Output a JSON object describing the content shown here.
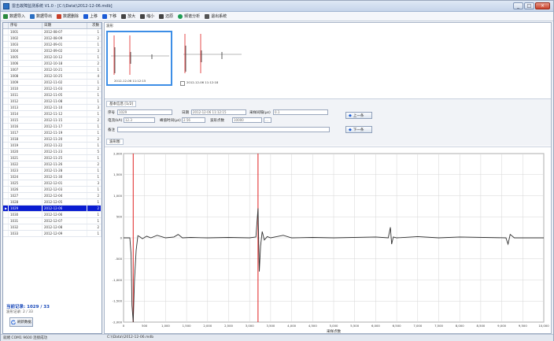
{
  "window": {
    "title": "雷击故障监测系统 V1.0 - [C:\\\\Data\\\\2012-12-06.mdb]",
    "controls": [
      "_",
      "□",
      "×"
    ]
  },
  "toolbar": {
    "items": [
      {
        "label": "数据导入",
        "icon": "import-icon"
      },
      {
        "label": "数据导出",
        "icon": "export-icon"
      },
      {
        "label": "数据删除",
        "icon": "delete-icon"
      },
      {
        "label": "上移",
        "icon": "up-icon"
      },
      {
        "label": "下移",
        "icon": "down-icon"
      },
      {
        "label": "放大",
        "icon": "zoom-in-icon"
      },
      {
        "label": "缩小",
        "icon": "zoom-out-icon"
      },
      {
        "label": "还原",
        "icon": "restore-icon"
      },
      {
        "label": "频谱分析",
        "icon": "analysis-icon"
      },
      {
        "label": "退出系统",
        "icon": "exit-icon"
      }
    ]
  },
  "list": {
    "headers": [
      "",
      "序号",
      "日期",
      "次数"
    ],
    "rows": [
      {
        "no": "1001",
        "date": "2012-08-07",
        "cnt": "1"
      },
      {
        "no": "1002",
        "date": "2012-08-09",
        "cnt": "2"
      },
      {
        "no": "1003",
        "date": "2012-09-01",
        "cnt": "1"
      },
      {
        "no": "1004",
        "date": "2012-09-02",
        "cnt": "3"
      },
      {
        "no": "1005",
        "date": "2012-10-12",
        "cnt": "1"
      },
      {
        "no": "1006",
        "date": "2012-10-18",
        "cnt": "2"
      },
      {
        "no": "1007",
        "date": "2012-10-21",
        "cnt": "1"
      },
      {
        "no": "1008",
        "date": "2012-10-25",
        "cnt": "4"
      },
      {
        "no": "1009",
        "date": "2012-11-02",
        "cnt": "1"
      },
      {
        "no": "1010",
        "date": "2012-11-03",
        "cnt": "2"
      },
      {
        "no": "1011",
        "date": "2012-11-05",
        "cnt": "1"
      },
      {
        "no": "1012",
        "date": "2012-11-08",
        "cnt": "1"
      },
      {
        "no": "1013",
        "date": "2012-11-10",
        "cnt": "3"
      },
      {
        "no": "1014",
        "date": "2012-11-12",
        "cnt": "1"
      },
      {
        "no": "1015",
        "date": "2012-11-15",
        "cnt": "2"
      },
      {
        "no": "1016",
        "date": "2012-11-17",
        "cnt": "1"
      },
      {
        "no": "1017",
        "date": "2012-11-19",
        "cnt": "1"
      },
      {
        "no": "1018",
        "date": "2012-11-20",
        "cnt": "2"
      },
      {
        "no": "1019",
        "date": "2012-11-22",
        "cnt": "1"
      },
      {
        "no": "1020",
        "date": "2012-11-23",
        "cnt": "5"
      },
      {
        "no": "1021",
        "date": "2012-11-25",
        "cnt": "1"
      },
      {
        "no": "1022",
        "date": "2012-11-26",
        "cnt": "2"
      },
      {
        "no": "1023",
        "date": "2012-11-28",
        "cnt": "1"
      },
      {
        "no": "1024",
        "date": "2012-11-30",
        "cnt": "1"
      },
      {
        "no": "1025",
        "date": "2012-12-01",
        "cnt": "3"
      },
      {
        "no": "1026",
        "date": "2012-12-03",
        "cnt": "1"
      },
      {
        "no": "1027",
        "date": "2012-12-04",
        "cnt": "2"
      },
      {
        "no": "1028",
        "date": "2012-12-05",
        "cnt": "1"
      },
      {
        "no": "1029",
        "date": "2012-12-06",
        "cnt": "2",
        "selected": true
      },
      {
        "no": "1030",
        "date": "2012-12-06",
        "cnt": "1"
      },
      {
        "no": "1031",
        "date": "2012-12-07",
        "cnt": "1"
      },
      {
        "no": "1032",
        "date": "2012-12-08",
        "cnt": "2"
      },
      {
        "no": "1033",
        "date": "2012-12-09",
        "cnt": "1"
      }
    ],
    "footer": {
      "code": "当前记录: 1029 / 33",
      "sub": "波形记录: 2 / 33",
      "refresh_label": "刷新数据"
    }
  },
  "thumbnails": {
    "tab_label": "波形",
    "items": [
      {
        "caption": "2012-12-06 11:12:15",
        "selected": true
      },
      {
        "caption": "2012-12-06 11:12:18",
        "selected": false
      }
    ]
  },
  "info": {
    "tab_label": "基本信息 [1/2]",
    "fields": {
      "no_label": "序号",
      "no_value": "1029",
      "date_label": "日期",
      "date_value": "2012-12-06 11:12:15",
      "interval_label": "采样间隔(μs)",
      "interval_value": "0.1",
      "current_label": "电流(kA)",
      "current_value": "12.3",
      "peak_label": "峰值时间(μs)",
      "peak_value": "2.56",
      "count_label": "波形点数",
      "count_value": "10000",
      "remark_label": "备注",
      "remark_value": ""
    },
    "prev_label": "上一条",
    "next_label": "下一条",
    "wave_tab_label": "波形图"
  },
  "chart_data": {
    "type": "line",
    "title": "",
    "xlabel": "采样点数",
    "ylabel": "",
    "xlim": [
      0,
      10000
    ],
    "ylim": [
      -2000,
      2000
    ],
    "x_ticks": [
      0,
      500,
      1000,
      1500,
      2000,
      2500,
      3000,
      3500,
      4000,
      4500,
      5000,
      5500,
      6000,
      6500,
      7000,
      7500,
      8000,
      8500,
      9000,
      9500,
      10000
    ],
    "y_ticks": [
      -2000,
      -1500,
      -1000,
      -500,
      0,
      500,
      1000,
      1500,
      2000
    ],
    "markers": [
      {
        "x": 230,
        "color": "#e02020"
      },
      {
        "x": 3200,
        "color": "#e02020"
      }
    ],
    "grid": true,
    "series": [
      {
        "color": "#303030",
        "x": [
          0,
          150,
          180,
          200,
          230,
          260,
          300,
          340,
          380,
          450,
          550,
          650,
          800,
          1000,
          1200,
          1300,
          1400,
          1600,
          2000,
          2500,
          3000,
          3150,
          3200,
          3230,
          3260,
          3300,
          3350,
          3420,
          3500,
          3600,
          3800,
          4000,
          4500,
          5000,
          6000,
          6300,
          6350,
          6380,
          6420,
          6500,
          7000,
          7500,
          8000,
          9100,
          9150,
          9200,
          9300,
          10000
        ],
        "y": [
          0,
          0,
          -400,
          -1600,
          -2000,
          -1000,
          -300,
          50,
          30,
          -20,
          40,
          0,
          60,
          0,
          20,
          80,
          0,
          10,
          0,
          10,
          0,
          20,
          700,
          -800,
          -200,
          150,
          -50,
          30,
          0,
          20,
          60,
          0,
          10,
          0,
          20,
          0,
          250,
          -150,
          20,
          0,
          30,
          0,
          20,
          0,
          -150,
          80,
          0,
          0
        ]
      }
    ]
  },
  "statusbar": {
    "left": "就绪  COM1 9600 连接成功",
    "right": "C:\\\\Data\\\\2012-12-06.mdb"
  },
  "colors": {
    "selected_row": "#0a1cd1",
    "marker": "#e02020",
    "trace": "#303030",
    "accent": "#3d8ee6"
  }
}
